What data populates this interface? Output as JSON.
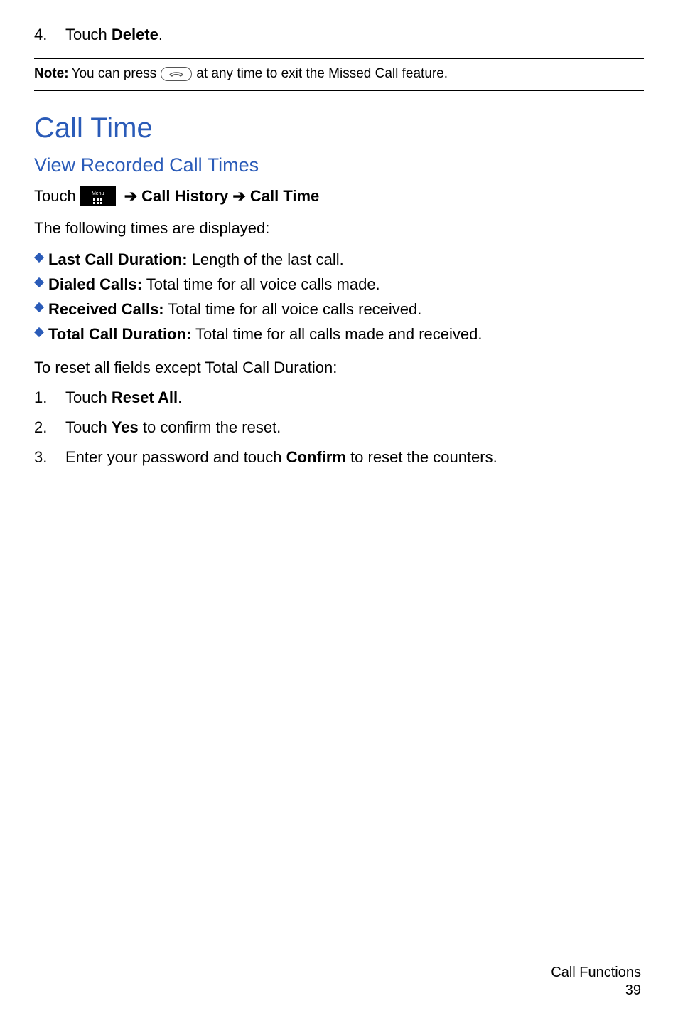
{
  "step4": {
    "num": "4.",
    "prefix": "Touch ",
    "bold": "Delete",
    "suffix": "."
  },
  "note": {
    "label": "Note:",
    "before": " You can press ",
    "after": " at any time to exit the Missed Call feature."
  },
  "h1": "Call Time",
  "h2": "View Recorded Call Times",
  "touch": {
    "prefix": "Touch ",
    "menuLabel": "Menu",
    "arrow1": "➔",
    "path1": "Call History",
    "arrow2": "➔",
    "path2": "Call Time"
  },
  "following": "The following times are displayed:",
  "bullets": [
    {
      "bold": "Last Call Duration:",
      "rest": " Length of the last call."
    },
    {
      "bold": "Dialed Calls:",
      "rest": " Total time for all voice calls made."
    },
    {
      "bold": "Received Calls:",
      "rest": " Total time for all voice calls received."
    },
    {
      "bold": "Total Call Duration:",
      "rest": " Total time for all calls made and received."
    }
  ],
  "resetIntro": "To reset all fields except Total Call Duration:",
  "resetSteps": [
    {
      "num": "1.",
      "parts": [
        {
          "t": "Touch "
        },
        {
          "b": "Reset All"
        },
        {
          "t": "."
        }
      ]
    },
    {
      "num": "2.",
      "parts": [
        {
          "t": "Touch "
        },
        {
          "b": "Yes"
        },
        {
          "t": " to confirm the reset."
        }
      ]
    },
    {
      "num": "3.",
      "parts": [
        {
          "t": "Enter your password and touch "
        },
        {
          "b": "Confirm"
        },
        {
          "t": " to reset the counters."
        }
      ]
    }
  ],
  "footer": {
    "section": "Call Functions",
    "page": "39"
  }
}
